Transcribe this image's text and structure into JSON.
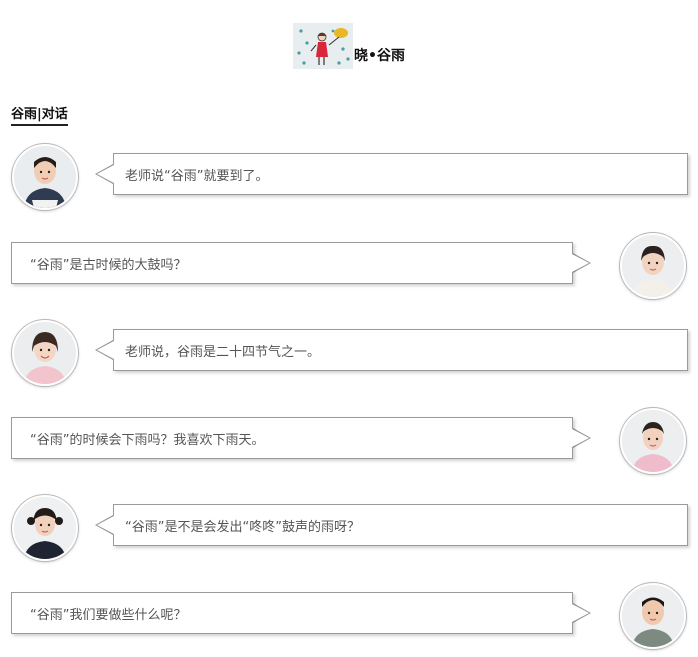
{
  "header": {
    "title": "晓•谷雨"
  },
  "section": {
    "title": "谷雨|对话"
  },
  "dialogues": [
    {
      "side": "left",
      "text": "老师说“谷雨”就要到了。"
    },
    {
      "side": "right",
      "text": "“谷雨”是古时候的大鼓吗？"
    },
    {
      "side": "left",
      "text": "老师说，谷雨是二十四节气之一。"
    },
    {
      "side": "right",
      "text": "“谷雨”的时候会下雨吗？我喜欢下雨天。"
    },
    {
      "side": "left",
      "text": " “谷雨”是不是会发出“咚咚”鼓声的雨呀？"
    },
    {
      "side": "right",
      "text": "“谷雨”我们要做些什么呢？"
    }
  ]
}
